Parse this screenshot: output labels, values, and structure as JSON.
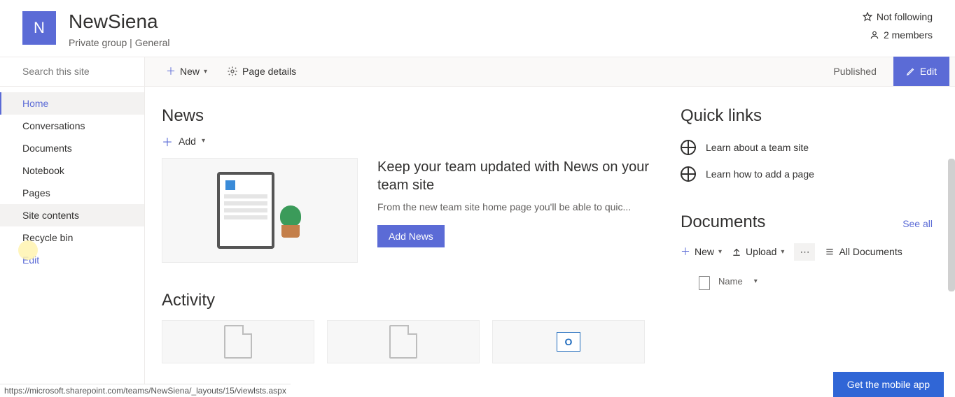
{
  "header": {
    "logo_letter": "N",
    "site_title": "NewSiena",
    "group_type": "Private group",
    "channel": "General",
    "follow_label": "Not following",
    "members_label": "2 members"
  },
  "search": {
    "placeholder": "Search this site"
  },
  "nav": {
    "items": [
      {
        "label": "Home",
        "active": true
      },
      {
        "label": "Conversations"
      },
      {
        "label": "Documents"
      },
      {
        "label": "Notebook"
      },
      {
        "label": "Pages"
      },
      {
        "label": "Site contents",
        "hovered": true
      },
      {
        "label": "Recycle bin"
      }
    ],
    "edit_label": "Edit"
  },
  "toolbar": {
    "new_label": "New",
    "page_details_label": "Page details",
    "published_label": "Published",
    "edit_label": "Edit"
  },
  "news": {
    "heading": "News",
    "add_label": "Add",
    "title": "Keep your team updated with News on your team site",
    "desc": "From the new team site home page you'll be able to quic...",
    "add_news_button": "Add News"
  },
  "activity": {
    "heading": "Activity"
  },
  "quick_links": {
    "heading": "Quick links",
    "items": [
      {
        "label": "Learn about a team site"
      },
      {
        "label": "Learn how to add a page"
      }
    ]
  },
  "documents": {
    "heading": "Documents",
    "see_all": "See all",
    "tb_new": "New",
    "tb_upload": "Upload",
    "tb_all": "All Documents",
    "col_name": "Name"
  },
  "mobile_app_label": "Get the mobile app",
  "status_url": "https://microsoft.sharepoint.com/teams/NewSiena/_layouts/15/viewlsts.aspx"
}
